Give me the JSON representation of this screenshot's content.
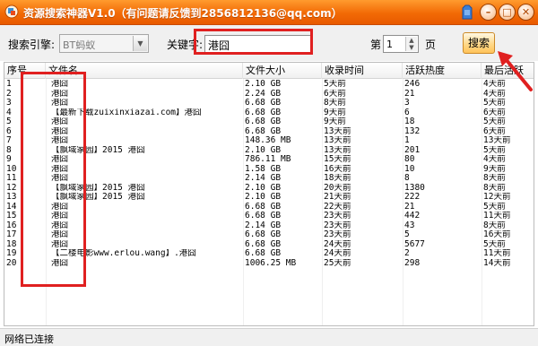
{
  "window": {
    "title": "资源搜索神器V1.0（有问题请反馈到2856812136@qq.com）",
    "minimize_glyph": "–",
    "maximize_glyph": "□",
    "close_glyph": "✕"
  },
  "toolbar": {
    "engine_label": "搜索引擎:",
    "engine_value": "BT蚂蚁",
    "keyword_label": "关键字:",
    "keyword_value": "港囧",
    "page_prefix": "第",
    "page_value": "1",
    "page_suffix": "页",
    "search_label": "搜索"
  },
  "table": {
    "columns": [
      "序号",
      "文件名",
      "文件大小",
      "收录时间",
      "活跃热度",
      "最后活跃"
    ],
    "rows": [
      [
        "1",
        "港囧",
        "2.10 GB",
        "5天前",
        "246",
        "4天前"
      ],
      [
        "2",
        "港囧",
        "2.24 GB",
        "6天前",
        "21",
        "4天前"
      ],
      [
        "3",
        "港囧",
        "6.68 GB",
        "8天前",
        "3",
        "5天前"
      ],
      [
        "4",
        "【最新下载zuixinxiazai.com】港囧",
        "6.68 GB",
        "9天前",
        "6",
        "6天前"
      ],
      [
        "5",
        "港囧",
        "6.68 GB",
        "9天前",
        "18",
        "5天前"
      ],
      [
        "6",
        "港囧",
        "6.68 GB",
        "13天前",
        "132",
        "6天前"
      ],
      [
        "7",
        "港囧",
        "148.36 MB",
        "13天前",
        "1",
        "13天前"
      ],
      [
        "8",
        "【飘域家园】2015 港囧",
        "2.10 GB",
        "13天前",
        "201",
        "5天前"
      ],
      [
        "9",
        "港囧",
        "786.11 MB",
        "15天前",
        "80",
        "4天前"
      ],
      [
        "10",
        "港囧",
        "1.58 GB",
        "16天前",
        "10",
        "9天前"
      ],
      [
        "11",
        "港囧",
        "2.14 GB",
        "18天前",
        "8",
        "8天前"
      ],
      [
        "12",
        "【飘域家园】2015 港囧",
        "2.10 GB",
        "20天前",
        "1380",
        "8天前"
      ],
      [
        "13",
        "【飘域家园】2015 港囧",
        "2.10 GB",
        "21天前",
        "222",
        "12天前"
      ],
      [
        "14",
        "港囧",
        "6.68 GB",
        "22天前",
        "21",
        "5天前"
      ],
      [
        "15",
        "港囧",
        "6.68 GB",
        "23天前",
        "442",
        "11天前"
      ],
      [
        "16",
        "港囧",
        "2.14 GB",
        "23天前",
        "43",
        "8天前"
      ],
      [
        "17",
        "港囧",
        "6.68 GB",
        "23天前",
        "5",
        "16天前"
      ],
      [
        "18",
        "港囧",
        "6.68 GB",
        "24天前",
        "5677",
        "5天前"
      ],
      [
        "19",
        "【二楼电影www.erlou.wang】.港囧",
        "6.68 GB",
        "24天前",
        "2",
        "11天前"
      ],
      [
        "20",
        "港囧",
        "1006.25 MB",
        "25天前",
        "298",
        "14天前"
      ]
    ]
  },
  "status": {
    "text": "网络已连接"
  },
  "colors": {
    "titlebar": "#f26a05",
    "annotation_red": "#e02020"
  },
  "icons": [
    "app-logo-icon",
    "skin-icon",
    "minimize-icon",
    "maximize-icon",
    "close-icon",
    "dropdown-arrow-icon",
    "spin-arrow-icon"
  ]
}
